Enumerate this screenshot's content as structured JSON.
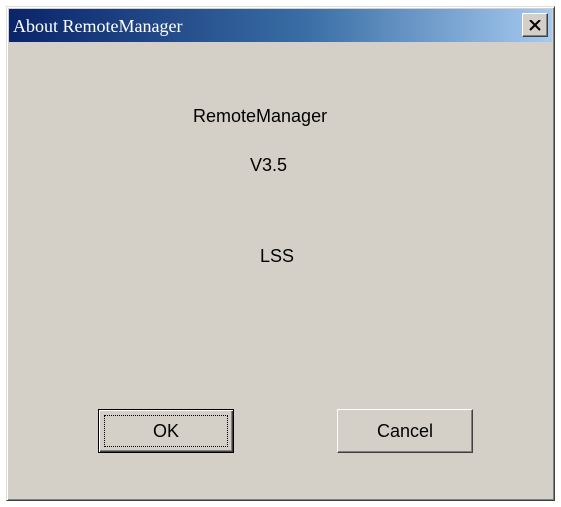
{
  "window": {
    "title": "About RemoteManager",
    "close_icon": "close-x-icon"
  },
  "content": {
    "app_name": "RemoteManager",
    "version": "V3.5",
    "company": "LSS"
  },
  "buttons": {
    "ok_label": "OK",
    "cancel_label": "Cancel"
  },
  "colors": {
    "dialog_face": "#d4d0c8",
    "titlebar_start": "#0a246a",
    "titlebar_end": "#a6caf0"
  }
}
